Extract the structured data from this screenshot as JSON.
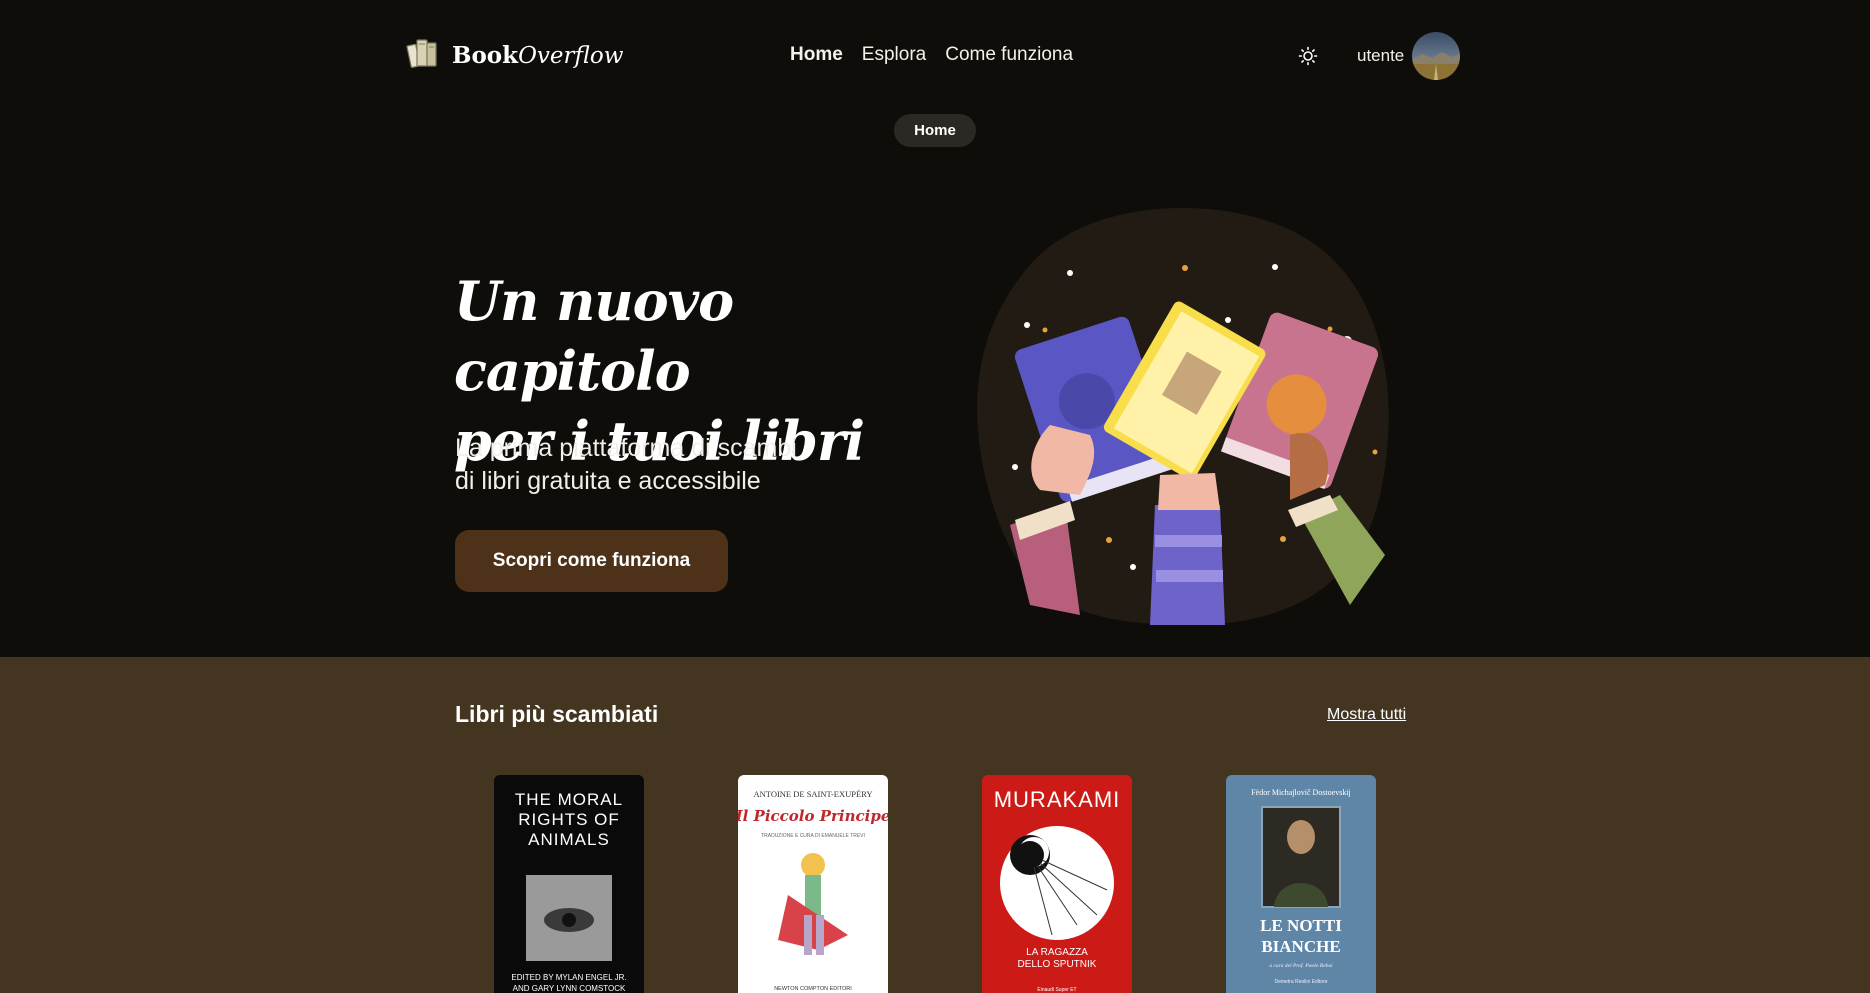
{
  "app": {
    "logo": {
      "word1": "Book",
      "word2": "Overflow"
    }
  },
  "nav": {
    "items": [
      {
        "label": "Home",
        "active": true
      },
      {
        "label": "Esplora",
        "active": false
      },
      {
        "label": "Come funziona",
        "active": false
      }
    ]
  },
  "user": {
    "name": "utente"
  },
  "breadcrumb": {
    "label": "Home"
  },
  "hero": {
    "title_line1": "Un nuovo capitolo",
    "title_line2": "per i tuoi libri",
    "subtitle_line1": "La prima piattaforma di scambi",
    "subtitle_line2": "di libri gratuita e accessibile",
    "cta_label": "Scopri come funziona"
  },
  "popular": {
    "title": "Libri più scambiati",
    "show_all_label": "Mostra tutti",
    "books": [
      {
        "cover_lines": [
          "THE MORAL",
          "RIGHTS OF",
          "ANIMALS"
        ],
        "editors": [
          "EDITED BY MYLAN ENGEL JR.",
          "AND GARY LYNN COMSTOCK"
        ],
        "cover_color": "#0a0a0a"
      },
      {
        "author": "ANTOINE DE SAINT-EXUPÉRY",
        "title": "Il Piccolo Principe",
        "note": "TRADUZIONE E CURA DI EMANUELE TREVI",
        "publisher": "NEWTON COMPTON EDITORI",
        "cover_color": "#ffffff"
      },
      {
        "author": "MURAKAMI",
        "title_lines": [
          "LA RAGAZZA",
          "DELLO SPUTNIK"
        ],
        "publisher": "Einaudi Super ET",
        "cover_color": "#cc1a16"
      },
      {
        "author": "Fëdor Michajlovič Dostoevskij",
        "title_lines": [
          "LE NOTTI",
          "BIANCHE"
        ],
        "note": "a cura del Prof. Paolo Rebai",
        "publisher": "Demetra Reolini Editore",
        "cover_color": "#5f86a6"
      }
    ]
  },
  "colors": {
    "background": "#0f0d09",
    "section_background": "#443521",
    "cta_background": "#4d3119"
  },
  "icons": {
    "logo": "books-icon",
    "theme": "sun-icon"
  }
}
